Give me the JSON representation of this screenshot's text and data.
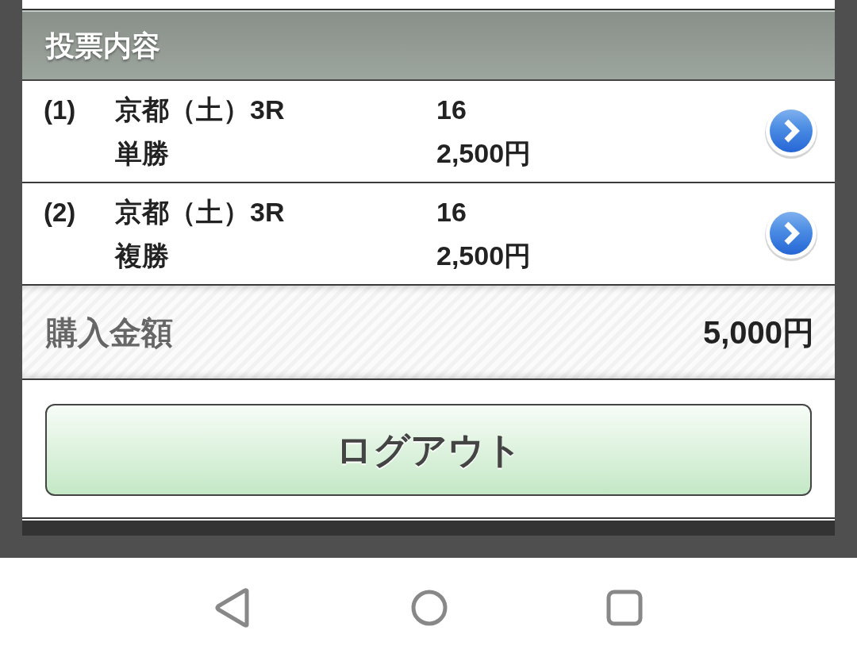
{
  "section": {
    "title": "投票内容"
  },
  "bets": [
    {
      "number": "(1)",
      "venue": "京都（土）3R",
      "bet_type": "単勝",
      "selection": "16",
      "amount": "2,500円"
    },
    {
      "number": "(2)",
      "venue": "京都（土）3R",
      "bet_type": "複勝",
      "selection": "16",
      "amount": "2,500円"
    }
  ],
  "total": {
    "label": "購入金額",
    "amount": "5,000円"
  },
  "logout_button": {
    "label": "ログアウト"
  }
}
